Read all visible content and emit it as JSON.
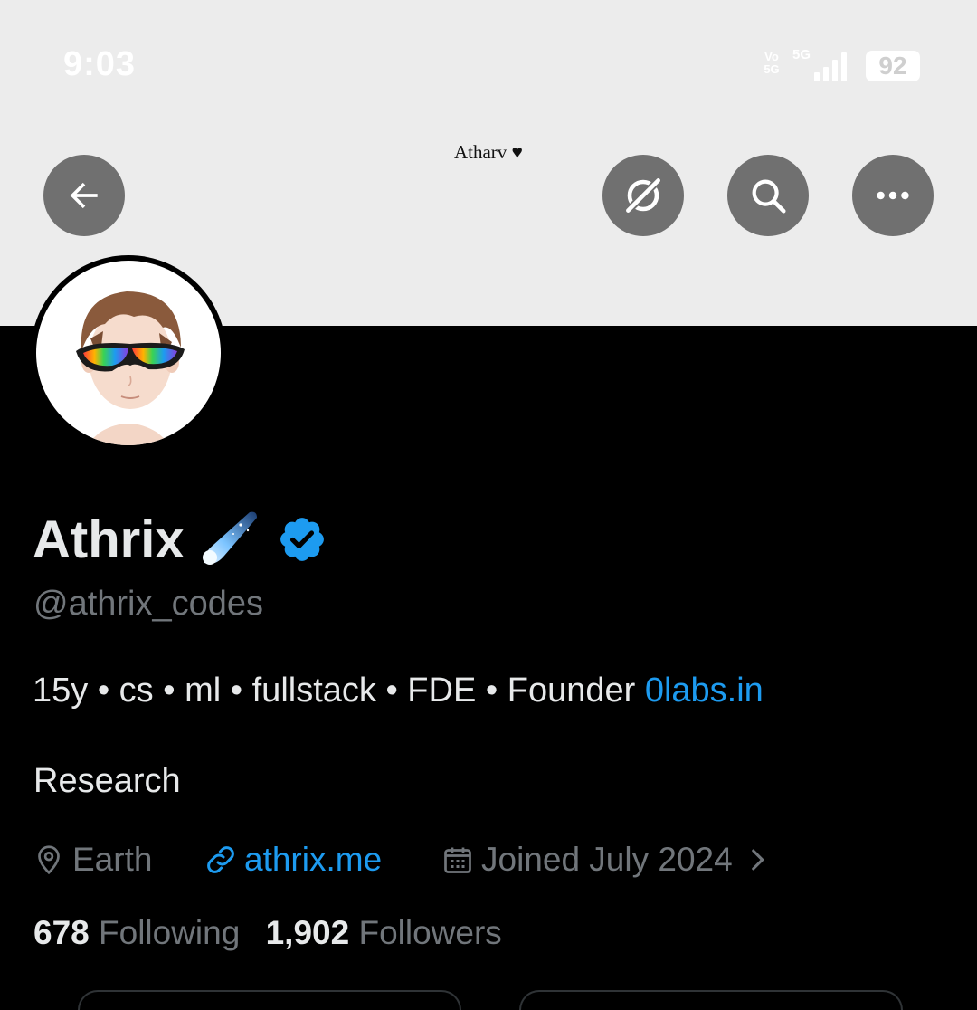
{
  "status_bar": {
    "time": "9:03",
    "volte": "Vo\n5G",
    "network": "5G",
    "battery": "92"
  },
  "banner": {
    "text": "Atharv ♥",
    "background": "#ececec"
  },
  "header_buttons": {
    "back_icon": "arrow-left-icon",
    "grok_icon": "grok-icon",
    "search_icon": "search-icon",
    "more_icon": "more-icon"
  },
  "profile": {
    "display_name": "Athrix",
    "handle": "@athrix_codes",
    "bio_text": "15y • cs • ml • fullstack • FDE • Founder ",
    "bio_link": "0labs.in",
    "bio_line2": "Research",
    "location": "Earth",
    "website": "athrix.me",
    "joined": "Joined July 2024",
    "following_count": "678",
    "following_label": "Following",
    "followers_count": "1,902",
    "followers_label": "Followers"
  },
  "colors": {
    "accent": "#1d9bf0",
    "secondary_text": "#71767b",
    "primary_text": "#e7e9ea",
    "background": "#000000"
  }
}
